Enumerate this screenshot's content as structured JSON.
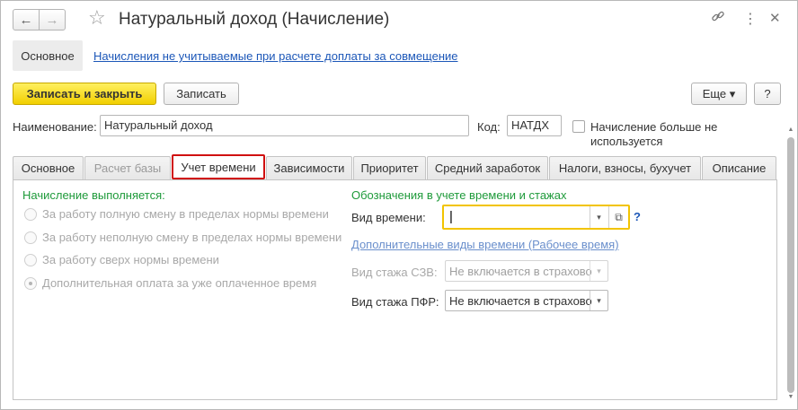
{
  "window": {
    "title": "Натуральный доход (Начисление)",
    "back_icon": "←",
    "forward_icon": "→",
    "star_icon": "☆",
    "link_icon": "🔗",
    "more_icon": "⋮",
    "close_icon": "✕"
  },
  "panel": {
    "main_label": "Основное",
    "link_label": "Начисления не учитываемые при расчете доплаты за совмещение"
  },
  "toolbar": {
    "save_close_label": "Записать и закрыть",
    "save_label": "Записать",
    "more_label": "Еще ▾",
    "help_label": "?"
  },
  "form": {
    "name_label": "Наименование:",
    "name_value": "Натуральный доход",
    "code_label": "Код:",
    "code_value": "НАТДХ",
    "not_used_label_line1": "Начисление больше не",
    "not_used_label_line2": "используется",
    "not_used_checked": false
  },
  "tabs": [
    {
      "label": "Основное"
    },
    {
      "label": "Расчет базы"
    },
    {
      "label": "Учет времени"
    },
    {
      "label": "Зависимости"
    },
    {
      "label": "Приоритет"
    },
    {
      "label": "Средний заработок"
    },
    {
      "label": "Налоги, взносы, бухучет"
    },
    {
      "label": "Описание"
    }
  ],
  "time_tab": {
    "executed_heading": "Начисление выполняется:",
    "options": [
      {
        "label": "За работу полную смену в пределах нормы времени",
        "selected": false
      },
      {
        "label": "За работу неполную смену в пределах нормы времени",
        "selected": false
      },
      {
        "label": "За работу сверх нормы времени",
        "selected": false
      },
      {
        "label": "Дополнительная оплата за уже оплаченное время",
        "selected": true
      }
    ],
    "designations_heading": "Обозначения в учете времени и стажах",
    "time_kind_label": "Вид времени:",
    "time_kind_value": "",
    "time_kind_help": "?",
    "extra_kinds_link": "Дополнительные виды времени (Рабочее время)",
    "szv_label": "Вид стажа СЗВ:",
    "szv_value": "Не включается в страхово",
    "pfr_label": "Вид стажа ПФР:",
    "pfr_value": "Не включается в страхово",
    "dropdown_icon": "▾",
    "open_icon": "⧉"
  },
  "scrollbar": {
    "up_icon": "▲",
    "down_icon": "▼"
  }
}
